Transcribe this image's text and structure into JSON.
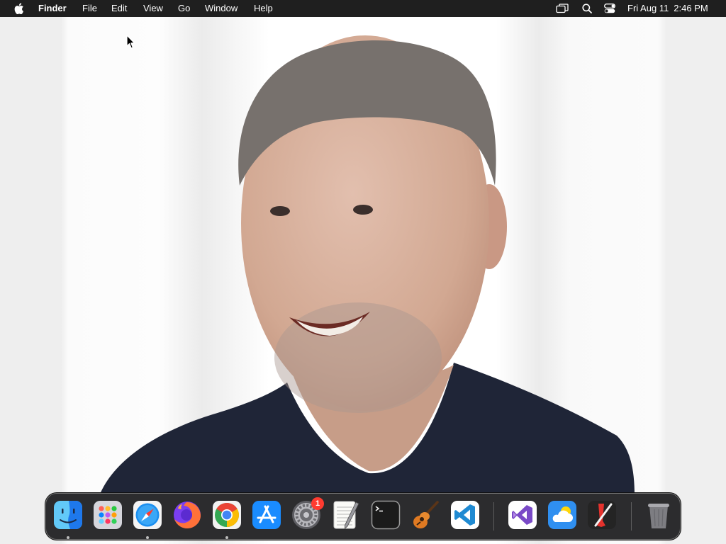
{
  "menubar": {
    "apple_icon": "apple-logo-icon",
    "app_name": "Finder",
    "menus": [
      "File",
      "Edit",
      "View",
      "Go",
      "Window",
      "Help"
    ],
    "status_icons": [
      "screen-mirroring-icon",
      "search-icon",
      "control-center-icon"
    ],
    "date": "Fri Aug 11",
    "time": "2:46 PM"
  },
  "desktop": {
    "wallpaper": "portrait-photo-wallpaper",
    "cursor_icon": "arrow-pointer-icon"
  },
  "dock": {
    "items": [
      {
        "icon": "finder-icon",
        "running": true
      },
      {
        "icon": "launchpad-icon",
        "running": false
      },
      {
        "icon": "safari-icon",
        "running": true
      },
      {
        "icon": "firefox-icon",
        "running": false
      },
      {
        "icon": "chrome-icon",
        "running": true
      },
      {
        "icon": "app-store-icon",
        "running": false
      },
      {
        "icon": "system-settings-icon",
        "running": false,
        "badge": "1"
      },
      {
        "icon": "textedit-icon",
        "running": false
      },
      {
        "icon": "terminal-icon",
        "running": false
      },
      {
        "icon": "garageband-icon",
        "running": false
      },
      {
        "icon": "vscode-icon",
        "running": false
      },
      {
        "icon": "visual-studio-icon",
        "running": false
      },
      {
        "icon": "weather-icon",
        "running": false
      },
      {
        "icon": "pen-tool-app-icon",
        "running": false
      },
      {
        "icon": "trash-icon",
        "running": false
      }
    ]
  },
  "colors": {
    "menubar_bg": "#1f1f1f",
    "menubar_text": "#ffffff",
    "dock_bg": "#2c2c2e",
    "badge": "#ff3b30",
    "desktop_bg": "#f4f4f4",
    "shirt": "#1f2537"
  }
}
